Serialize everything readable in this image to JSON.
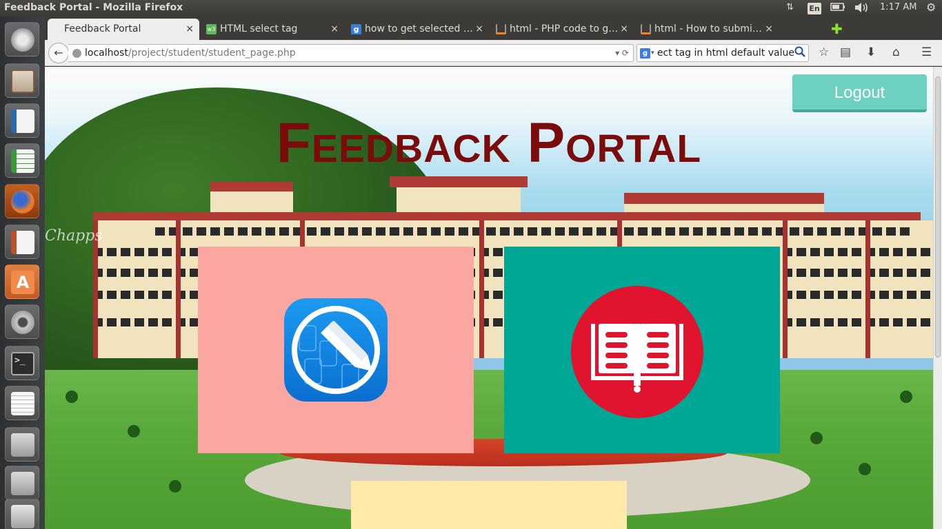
{
  "system": {
    "window_title": "Feedback Portal - Mozilla Firefox",
    "keyboard_layout": "En",
    "clock": "1:17 AM"
  },
  "tabs": [
    {
      "label": "Feedback Portal",
      "favicon": "blank-page-icon",
      "active": true
    },
    {
      "label": "HTML select tag",
      "favicon": "w3schools-icon"
    },
    {
      "label": "how to get selected …",
      "favicon": "google-icon"
    },
    {
      "label": "html - PHP code to g…",
      "favicon": "stackoverflow-icon"
    },
    {
      "label": "html - How to submi…",
      "favicon": "stackoverflow-icon"
    }
  ],
  "tab_close_glyph": "×",
  "navigation": {
    "url_host": "localhost",
    "url_path": "/project/student/student_page.php",
    "search_text": "select tag in html default value",
    "back_glyph": "←"
  },
  "page": {
    "title": "Feedback Portal",
    "logout_label": "Logout",
    "background_caption": "Chapps",
    "cards": [
      {
        "name": "give-feedback-card",
        "color": "#faa7a2",
        "icon": "sketch-pencil-icon"
      },
      {
        "name": "view-records-card",
        "color": "#01a796",
        "icon": "open-book-icon"
      },
      {
        "name": "third-card",
        "color": "#ffeaa9"
      }
    ]
  },
  "colors": {
    "title": "#7a0c0c",
    "logout": "#6dd0c0",
    "book_icon_red": "#e0142f",
    "sketch_icon_blue": "#1a8de8"
  }
}
